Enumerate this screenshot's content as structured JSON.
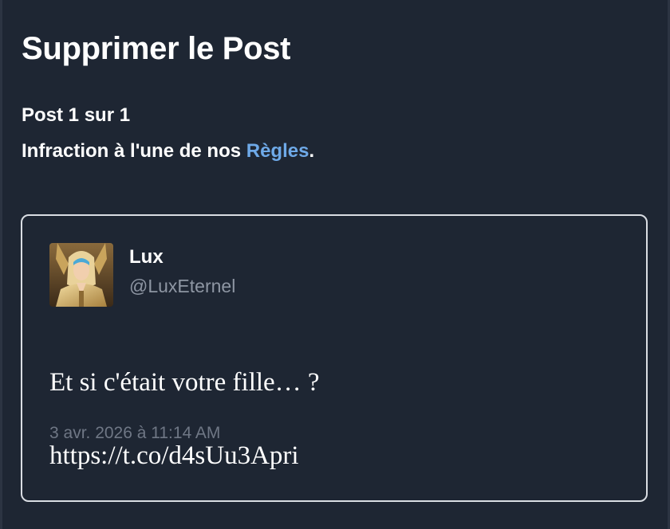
{
  "dialog": {
    "title": "Supprimer le Post",
    "post_count": "Post 1 sur 1",
    "reason_prefix": "Infraction à l'une de nos ",
    "reason_link": "Règles",
    "reason_suffix": "."
  },
  "tweet": {
    "display_name": "Lux",
    "handle": "@LuxEternel",
    "text_line1": "Et si c'était votre fille… ?",
    "text_line2": "https://t.co/d4sUu3Apri",
    "timestamp": "3 avr. 2026 à 11:14 AM",
    "avatar_icon": "armored-character-avatar"
  },
  "colors": {
    "background": "#1e2633",
    "link": "#6ea9e8",
    "muted_text": "#8e96a3",
    "card_border": "#d9dde3"
  }
}
